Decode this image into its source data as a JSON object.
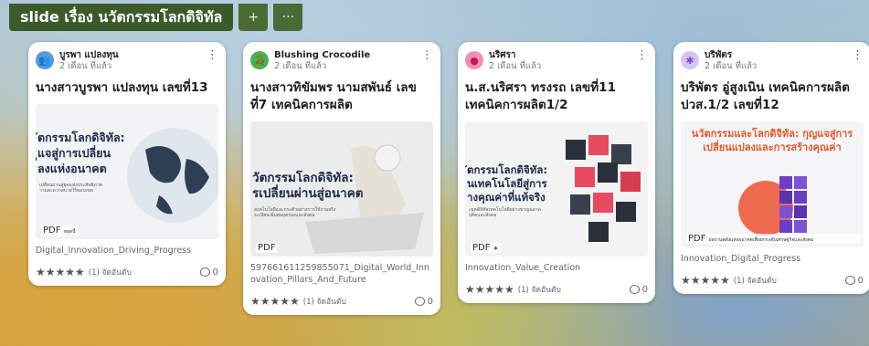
{
  "board": {
    "title": "slide เรื่อง นวัตกรรมโลกดิจิทัล",
    "add_icon": "+",
    "more_icon": "···"
  },
  "cards": [
    {
      "author": "บูรพา แปลงทุน",
      "time": "2 เดือน ที่แล้ว",
      "avatar_color": "#5b9bd5",
      "avatar_icon": "👥",
      "title": "นางสาวบูรพา แปลงทุน เลขที่13",
      "thumb_text": "ัตกรรมโลกดิจิทัล:\nุแจสู่การเปลี่ยน\nลงแห่งอนาคต",
      "thumb_sub": "เปลี่ยนผ่านสู่ยุคแห่งประสิทธิภาพ\nวามสะดวกสบายไร้ขอบเขต",
      "pdf": "PDF",
      "pdf_extra": "หยุดนี้",
      "filename": "Digital_Innovation_Driving_Progress",
      "stars": "★★★★★",
      "rating": "(1) จัดอันดับ",
      "comments": "0"
    },
    {
      "author": "Blushing Crocodile",
      "time": "2 เดือน ที่แล้ว",
      "avatar_color": "#4caf50",
      "avatar_icon": "🐊",
      "title": "นางสาวทิขัมพร นามสพันธ์ เลขที่7 เทคนิคการผลิต",
      "thumb_text": "วัตกรรมโลกดิจิทัล:\nรเปลี่ยนผ่านสู่อนาคต",
      "thumb_sub": "สงคโนโลยีและกระตัวอย่างการใช้งานจริง\nระเบียบเข้มต่อยุคร่องและสังคม",
      "pdf": "PDF",
      "pdf_extra": "",
      "filename": "597661611259855071_Digital_World_Innovation_Pillars_And_Future",
      "stars": "★★★★★",
      "rating": "(1) จัดอันดับ",
      "comments": "0"
    },
    {
      "author": "นริศรา",
      "time": "2 เดือน ที่แล้ว",
      "avatar_color": "#e91e63",
      "avatar_icon": "●",
      "title": "น.ส.นริศรา ทรงรถ เลขที่11 เทคนิคการผลิต1/2",
      "thumb_text": "ัตกรรมโลกดิจิทัล:\nนเทคโนโลยีสู่การ\nางคุณค่าที่แท้จริง",
      "thumb_sub": "ะยุคดิจิทัลเทคโนโลยีอย่างชาญฉลาด\nรคิดและสังคม",
      "pdf": "PDF",
      "pdf_extra": "∗",
      "filename": "Innovation_Value_Creation",
      "stars": "★★★★★",
      "rating": "(1) จัดอันดับ",
      "comments": "0"
    },
    {
      "author": "บริพัตร",
      "time": "2 เดือน ที่แล้ว",
      "avatar_color": "#9c6ade",
      "avatar_icon": "✱",
      "title": "บริพัตร อู่สูงเนิน เทคนิคการผลิต ปวส.1/2 เลขที่12",
      "thumb_text": "นวัตกรรมและโลกดิจิทัล: กุญแจสู่การ\nเปลี่ยนแปลงและการสร้างคุณค่า",
      "thumb_sub": "",
      "pdf": "PDF",
      "pdf_extra": "ผลงานพลังแห่งอนาคตเพื่อยกระดับเศรษฐกิจและสังคม",
      "filename": "Innovation_Digital_Progress",
      "stars": "★★★★★",
      "rating": "(1) จัดอันดับ",
      "comments": "0"
    }
  ]
}
